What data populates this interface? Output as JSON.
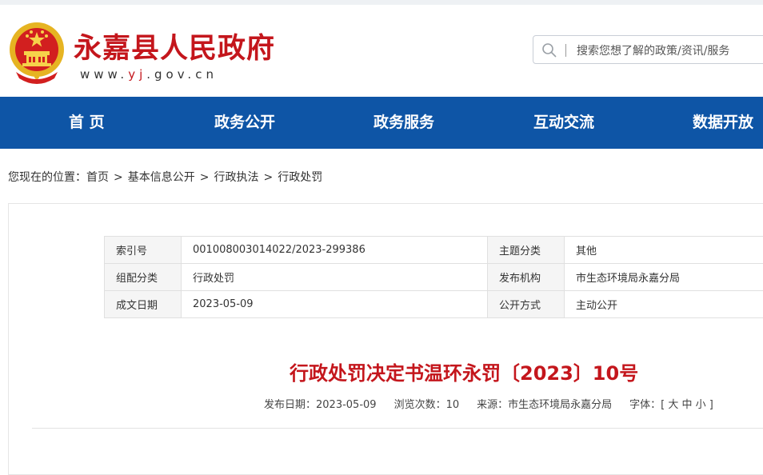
{
  "site": {
    "title": "永嘉县人民政府",
    "url_pre": "www.",
    "url_hl": "yj",
    "url_post": ".gov.cn"
  },
  "search": {
    "placeholder": "搜索您想了解的政策/资讯/服务"
  },
  "nav": [
    "首 页",
    "政务公开",
    "政务服务",
    "互动交流",
    "数据开放"
  ],
  "breadcrumb": {
    "prefix": "您现在的位置：",
    "items": [
      "首页",
      "基本信息公开",
      "行政执法",
      "行政处罚"
    ],
    "sep": ">"
  },
  "meta": {
    "rows": [
      {
        "k1": "索引号",
        "v1": "001008003014022/2023-299386",
        "k2": "主题分类",
        "v2": "其他"
      },
      {
        "k1": "组配分类",
        "v1": "行政处罚",
        "k2": "发布机构",
        "v2": "市生态环境局永嘉分局"
      },
      {
        "k1": "成文日期",
        "v1": "2023-05-09",
        "k2": "公开方式",
        "v2": "主动公开"
      }
    ]
  },
  "document": {
    "title": "行政处罚决定书温环永罚〔2023〕10号",
    "publish_date": "发布日期：2023-05-09",
    "views": "浏览次数：10",
    "source": "来源：市生态环境局永嘉分局",
    "font_size": "字体：[ 大 中 小 ]"
  },
  "colors": {
    "brand_red": "#c4161c",
    "nav_blue": "#0e55a6"
  },
  "icons": [
    "national-emblem-icon",
    "search-icon"
  ]
}
